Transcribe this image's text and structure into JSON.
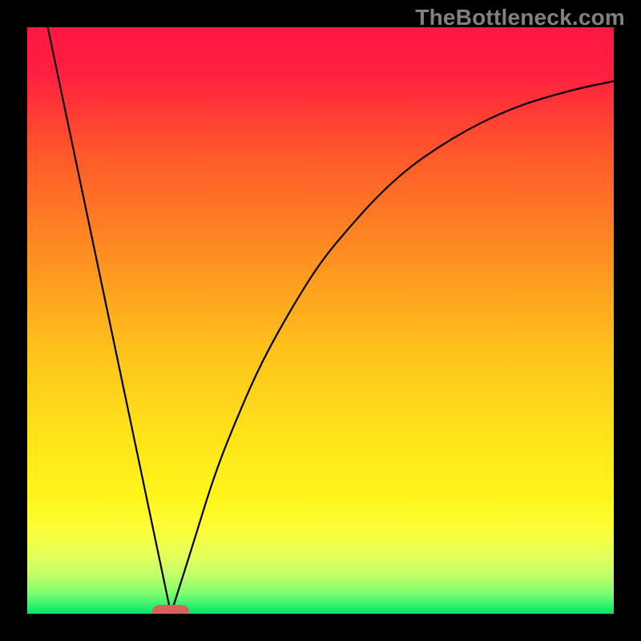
{
  "watermark": "TheBottleneck.com",
  "chart_data": {
    "type": "line",
    "title": "",
    "xlabel": "",
    "ylabel": "",
    "xlim": [
      0,
      100
    ],
    "ylim": [
      0,
      100
    ],
    "grid": false,
    "legend": false,
    "background_gradient": {
      "stops": [
        {
          "pos": 0.0,
          "color": "#ff1744"
        },
        {
          "pos": 0.08,
          "color": "#ff203f"
        },
        {
          "pos": 0.22,
          "color": "#ff5a2a"
        },
        {
          "pos": 0.38,
          "color": "#ff8c22"
        },
        {
          "pos": 0.55,
          "color": "#ffc21c"
        },
        {
          "pos": 0.7,
          "color": "#ffe41a"
        },
        {
          "pos": 0.8,
          "color": "#fff51a"
        },
        {
          "pos": 0.86,
          "color": "#fbff3a"
        },
        {
          "pos": 0.9,
          "color": "#e3ff5a"
        },
        {
          "pos": 0.935,
          "color": "#c0ff6a"
        },
        {
          "pos": 0.965,
          "color": "#7dff70"
        },
        {
          "pos": 1.0,
          "color": "#00e56a"
        }
      ]
    },
    "series": [
      {
        "name": "left-line",
        "x": [
          3.5,
          24.5
        ],
        "values": [
          100,
          0
        ]
      },
      {
        "name": "right-curve",
        "x": [
          24.5,
          28,
          32,
          36,
          40,
          45,
          50,
          55,
          60,
          65,
          70,
          75,
          80,
          85,
          90,
          95,
          100
        ],
        "values": [
          0,
          11,
          24,
          34,
          43,
          52,
          60,
          66,
          71.5,
          76,
          79.5,
          82.5,
          85,
          87,
          88.5,
          89.8,
          90.8
        ]
      }
    ],
    "marker": {
      "x": 24.5,
      "y": 0,
      "color": "#d9605b",
      "shape": "pill"
    }
  }
}
